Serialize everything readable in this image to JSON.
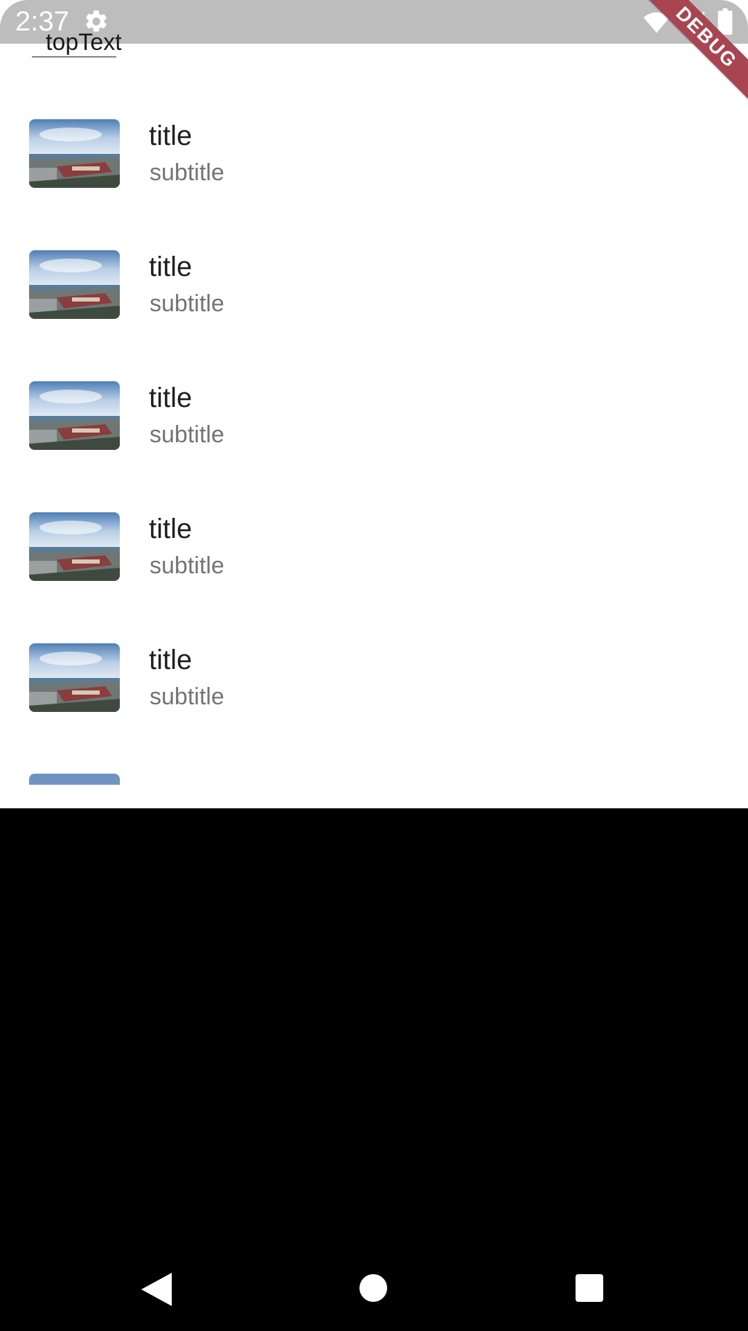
{
  "status_bar": {
    "time": "2:37",
    "icons": [
      "gear-icon",
      "wifi-icon",
      "signal-icon",
      "battery-icon"
    ]
  },
  "top_text": "topText",
  "debug_banner": "DEBUG",
  "list": {
    "items": [
      {
        "title": "title",
        "subtitle": "subtitle",
        "thumbnail": "harbor-photo"
      },
      {
        "title": "title",
        "subtitle": "subtitle",
        "thumbnail": "harbor-photo"
      },
      {
        "title": "title",
        "subtitle": "subtitle",
        "thumbnail": "harbor-photo"
      },
      {
        "title": "title",
        "subtitle": "subtitle",
        "thumbnail": "harbor-photo"
      },
      {
        "title": "title",
        "subtitle": "subtitle",
        "thumbnail": "harbor-photo"
      }
    ]
  },
  "navigation_bar": {
    "buttons": [
      "back-icon",
      "home-icon",
      "recents-icon"
    ]
  },
  "colors": {
    "status_bar": "#bdbdbd",
    "debug_banner": "#a94451",
    "title_text": "#1f1f1f",
    "subtitle_text": "#737373",
    "background": "#ffffff",
    "nav_background": "#000000"
  }
}
